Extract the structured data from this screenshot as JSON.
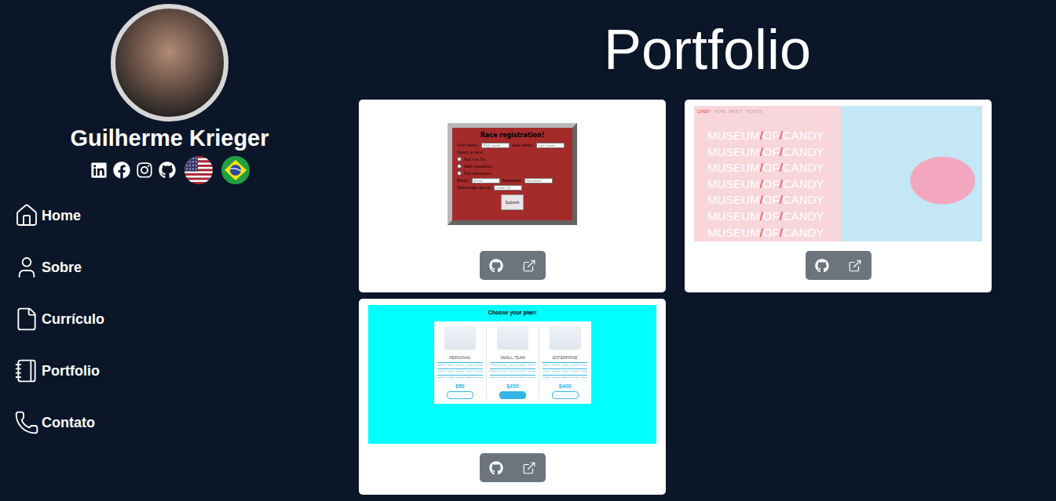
{
  "profile": {
    "name": "Guilherme Krieger"
  },
  "nav": [
    {
      "label": "Home"
    },
    {
      "label": "Sobre"
    },
    {
      "label": "Currículo"
    },
    {
      "label": "Portfolio"
    },
    {
      "label": "Contato"
    }
  ],
  "page": {
    "title": "Portfolio"
  },
  "projects": [
    {
      "kind": "race-form",
      "preview": {
        "title": "Race registration!",
        "name_fields": [
          {
            "label": "First name:",
            "placeholder": "First name"
          },
          {
            "label": "Last name:",
            "placeholder": "Last name"
          }
        ],
        "race_label": "Select a race:",
        "races": [
          {
            "label": "Fun run 5k",
            "selected": false
          },
          {
            "label": "Half marathon",
            "selected": false
          },
          {
            "label": "Full marathon",
            "selected": false
          }
        ],
        "account_fields": [
          {
            "label": "Email:",
            "placeholder": "Email"
          },
          {
            "label": "Password:",
            "placeholder": "Password"
          }
        ],
        "age_label": "Select age group:",
        "age_value": "under 18",
        "submit": "Submit"
      }
    },
    {
      "kind": "candy",
      "preview": {
        "brand": "CANDY",
        "links": [
          "HOME",
          "ABOUT",
          "TICKETS"
        ],
        "lines": [
          [
            {
              "text": "MUSEUM",
              "accent": false
            },
            {
              "text": "/",
              "accent": true
            },
            {
              "text": "OF",
              "accent": false
            },
            {
              "text": "/",
              "accent": true
            },
            {
              "text": "CANDY",
              "accent": false
            }
          ],
          [
            {
              "text": "MUSEUM",
              "accent": false
            },
            {
              "text": "/",
              "accent": true
            },
            {
              "text": "OF",
              "accent": false
            },
            {
              "text": "/",
              "accent": true
            },
            {
              "text": "CANDY",
              "accent": false
            }
          ],
          [
            {
              "text": "MUSEUM",
              "accent": false
            },
            {
              "text": "/",
              "accent": true
            },
            {
              "text": "OF",
              "accent": false
            },
            {
              "text": "/",
              "accent": true
            },
            {
              "text": "CANDY",
              "accent": false
            }
          ],
          [
            {
              "text": "MUSEUM",
              "accent": false
            },
            {
              "text": "/",
              "accent": true
            },
            {
              "text": "OF",
              "accent": false
            },
            {
              "text": "/",
              "accent": true
            },
            {
              "text": "CANDY",
              "accent": false
            }
          ],
          [
            {
              "text": "MUSEUM",
              "accent": false
            },
            {
              "text": "/",
              "accent": true
            },
            {
              "text": "OF",
              "accent": false
            },
            {
              "text": "/",
              "accent": true
            },
            {
              "text": "CANDY",
              "accent": false
            }
          ],
          [
            {
              "text": "MUSEUM",
              "accent": false
            },
            {
              "text": "/",
              "accent": true
            },
            {
              "text": "OF",
              "accent": false
            },
            {
              "text": "/",
              "accent": true
            },
            {
              "text": "CANDY",
              "accent": false
            }
          ],
          [
            {
              "text": "MUSEUM",
              "accent": false
            },
            {
              "text": "/",
              "accent": true
            },
            {
              "text": "OF",
              "accent": false
            },
            {
              "text": "/",
              "accent": true
            },
            {
              "text": "CANDY",
              "accent": false
            }
          ]
        ]
      }
    },
    {
      "kind": "plans",
      "preview": {
        "title": "Choose your plan!",
        "plans": [
          {
            "name": "PERSONAL",
            "price": "$50",
            "highlighted": false
          },
          {
            "name": "SMALL TEAM",
            "price": "$450",
            "highlighted": true
          },
          {
            "name": "ENTERPRISE",
            "price": "$400",
            "highlighted": false
          }
        ]
      }
    }
  ]
}
